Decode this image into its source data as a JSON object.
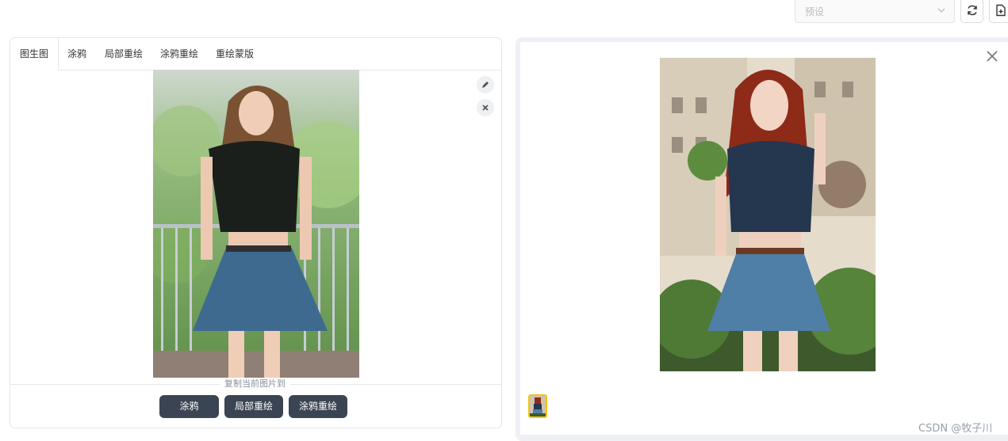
{
  "top_bar": {
    "preset_placeholder": "预设",
    "buttons": [
      {
        "name": "refresh-button",
        "icon": "refresh-icon"
      },
      {
        "name": "save-preset-button",
        "icon": "add-file-icon"
      }
    ]
  },
  "left_panel": {
    "tabs": [
      "图生图",
      "涂鸦",
      "局部重绘",
      "涂鸦重绘",
      "重绘蒙版"
    ],
    "active_tab": "图生图",
    "image_tools": [
      "pencil-icon",
      "close-icon"
    ],
    "copy_label": "复制当前图片到",
    "copy_buttons": [
      "涂鸦",
      "局部重绘",
      "涂鸦重绘"
    ]
  },
  "right_panel": {
    "close_icon": "close-icon",
    "thumbnail_count": 1
  },
  "watermark": "CSDN @牧子川",
  "colors": {
    "dark_button": "#3b4452",
    "thumbnail_border": "#f0c419",
    "panel_border": "#e5e7eb"
  }
}
